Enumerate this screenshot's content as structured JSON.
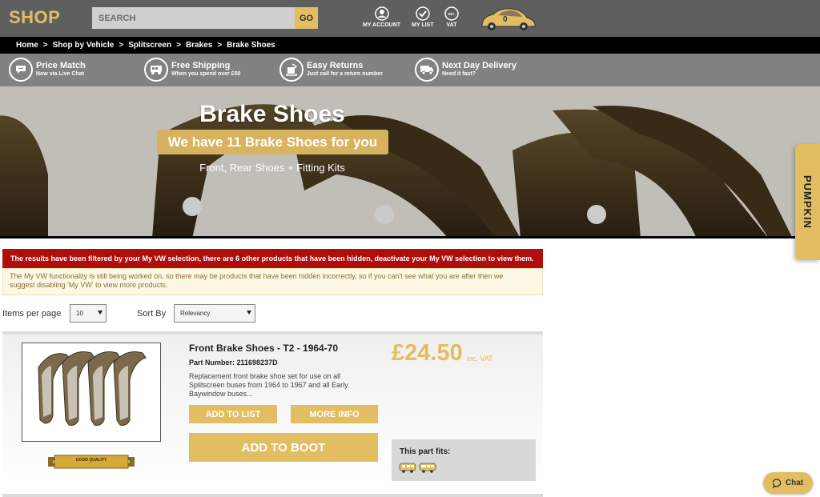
{
  "header": {
    "logo": "SHOP",
    "search_placeholder": "SEARCH",
    "go_label": "GO",
    "my_account": "MY ACCOUNT",
    "my_list": "MY LIST",
    "vat": "VAT",
    "vat_icon_text": "INC.",
    "boot_count": "0"
  },
  "breadcrumb": [
    "Home",
    "Shop by Vehicle",
    "Splitscreen",
    "Brakes",
    "Brake Shoes"
  ],
  "breadcrumb_sep": ">",
  "usp": [
    {
      "title": "Price Match",
      "sub": "Now via Live Chat",
      "icon": "chat-bubble-icon"
    },
    {
      "title": "Free Shipping",
      "sub": "When you spend over £50",
      "icon": "van-icon"
    },
    {
      "title": "Easy Returns",
      "sub": "Just call for a return number",
      "icon": "returns-icon"
    },
    {
      "title": "Next Day Delivery",
      "sub": "Need it fast?",
      "icon": "delivery-van-icon"
    }
  ],
  "hero": {
    "title": "Brake Shoes",
    "count_text": "We have 11 Brake Shoes for you",
    "subtitle": "Front, Rear Shoes + Fitting Kits"
  },
  "pumpkin_tab": "PUMPKIN",
  "alerts": {
    "filtered": "The results have been filtered by your My VW selection, there are 6 other products that have been hidden, deactivate your My VW selection to view them.",
    "info_line1": "The My VW functionality is still being worked on, so there may be products that have been hidden incorrectly, so if you can't see what you are after then we",
    "info_line2": "suggest disabling 'My VW' to view more products."
  },
  "controls": {
    "items_label": "Items per page",
    "items_value": "10",
    "sort_label": "Sort By",
    "sort_value": "Relevancy"
  },
  "product": {
    "title": "Front Brake Shoes - T2 - 1964-70",
    "part_label": "Part Number:",
    "part_number": "211698237D",
    "description": "Replacement front brake shoe set for use on all Splitscreen buses from 1964 to 1967 and all Early Baywindow buses...",
    "price": "£24.50",
    "price_suffix": "inc. VAT",
    "add_to_list": "ADD TO LIST",
    "more_info": "MORE INFO",
    "add_to_boot": "ADD TO BOOT",
    "badge": "GOOD QUALITY",
    "fits_label": "This part fits:"
  },
  "chat_label": "Chat",
  "colors": {
    "gold": "#e2bd61",
    "alert_red": "#b10d0d",
    "header_grey": "#5f5f5f"
  }
}
